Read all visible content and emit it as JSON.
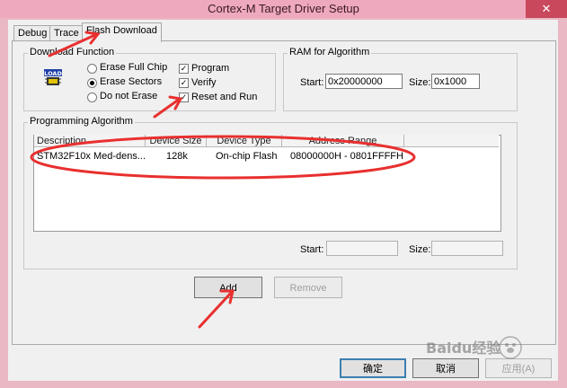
{
  "window": {
    "title": "Cortex-M Target Driver Setup",
    "close_glyph": "✕"
  },
  "tabs": [
    {
      "label": "Debug"
    },
    {
      "label": "Trace"
    },
    {
      "label": "Flash Download",
      "active": true
    }
  ],
  "download_function": {
    "title": "Download Function",
    "icon": "load-chip-icon",
    "icon_text": "LOAD",
    "radios": [
      {
        "label": "Erase Full Chip",
        "selected": false
      },
      {
        "label": "Erase Sectors",
        "selected": true
      },
      {
        "label": "Do not Erase",
        "selected": false
      }
    ],
    "checks": [
      {
        "label": "Program",
        "checked": true
      },
      {
        "label": "Verify",
        "checked": true
      },
      {
        "label": "Reset and Run",
        "checked": true
      }
    ]
  },
  "ram": {
    "title": "RAM for Algorithm",
    "start_label": "Start:",
    "start_value": "0x20000000",
    "size_label": "Size:",
    "size_value": "0x1000"
  },
  "programming": {
    "title": "Programming Algorithm",
    "columns": [
      "Description",
      "Device Size",
      "Device Type",
      "Address Range"
    ],
    "rows": [
      {
        "description": "STM32F10x Med-dens...",
        "size": "128k",
        "type": "On-chip Flash",
        "range": "08000000H - 0801FFFFH"
      }
    ],
    "start_label": "Start:",
    "start_value": "",
    "size_label": "Size:",
    "size_value": ""
  },
  "buttons": {
    "add": "Add",
    "remove": "Remove",
    "ok": "确定",
    "cancel": "取消",
    "apply": "应用(A)"
  },
  "watermark": {
    "text": "Baidu经验"
  },
  "colors": {
    "annotation": "#e8302f",
    "title_bar": "#efa9be",
    "dialog": "#f0f0f0"
  }
}
